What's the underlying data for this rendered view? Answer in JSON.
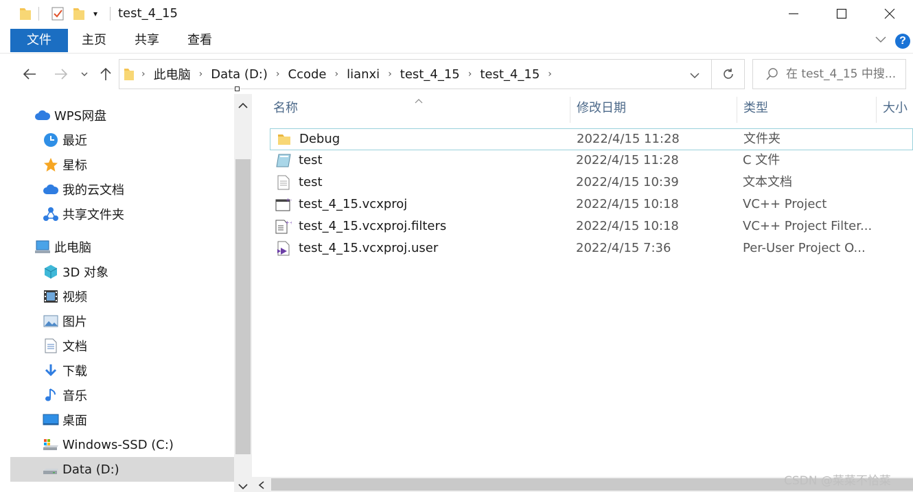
{
  "window": {
    "title": "test_4_15"
  },
  "ribbon": {
    "tabs": [
      {
        "label": "文件"
      },
      {
        "label": "主页"
      },
      {
        "label": "共享"
      },
      {
        "label": "查看"
      }
    ],
    "help_label": "?"
  },
  "address": {
    "crumbs": [
      "此电脑",
      "Data (D:)",
      "Ccode",
      "lianxi",
      "test_4_15",
      "test_4_15"
    ]
  },
  "search": {
    "placeholder": "在 test_4_15 中搜..."
  },
  "sidebar": {
    "items": [
      {
        "label": "WPS网盘",
        "icon": "cloud-icon"
      },
      {
        "label": "最近",
        "icon": "clock-icon"
      },
      {
        "label": "星标",
        "icon": "star-icon"
      },
      {
        "label": "我的云文档",
        "icon": "cloud-doc-icon"
      },
      {
        "label": "共享文件夹",
        "icon": "share-icon"
      },
      {
        "label": "此电脑",
        "icon": "computer-icon"
      },
      {
        "label": "3D 对象",
        "icon": "cube-icon"
      },
      {
        "label": "视频",
        "icon": "film-icon"
      },
      {
        "label": "图片",
        "icon": "picture-icon"
      },
      {
        "label": "文档",
        "icon": "document-icon"
      },
      {
        "label": "下载",
        "icon": "download-icon"
      },
      {
        "label": "音乐",
        "icon": "music-icon"
      },
      {
        "label": "桌面",
        "icon": "desktop-icon"
      },
      {
        "label": "Windows-SSD (C:)",
        "icon": "drive-icon"
      },
      {
        "label": "Data (D:)",
        "icon": "drive-icon"
      }
    ]
  },
  "columns": {
    "name": "名称",
    "date": "修改日期",
    "type": "类型",
    "size": "大小"
  },
  "files": [
    {
      "name": "Debug",
      "date": "2022/4/15 11:28",
      "type": "文件夹",
      "icon": "folder-icon"
    },
    {
      "name": "test",
      "date": "2022/4/15 11:28",
      "type": "C 文件",
      "icon": "c-file-icon"
    },
    {
      "name": "test",
      "date": "2022/4/15 10:39",
      "type": "文本文档",
      "icon": "text-file-icon"
    },
    {
      "name": "test_4_15.vcxproj",
      "date": "2022/4/15 10:18",
      "type": "VC++ Project",
      "icon": "vcxproj-icon"
    },
    {
      "name": "test_4_15.vcxproj.filters",
      "date": "2022/4/15 10:18",
      "type": "VC++ Project Filter...",
      "icon": "filters-icon"
    },
    {
      "name": "test_4_15.vcxproj.user",
      "date": "2022/4/15 7:36",
      "type": "Per-User Project O...",
      "icon": "vs-user-icon"
    }
  ],
  "watermark": "CSDN @菜菜不恰菜",
  "colors": {
    "accent": "#1b6ec2",
    "selected": "#d9d9d9",
    "folder": "#f5c453"
  }
}
